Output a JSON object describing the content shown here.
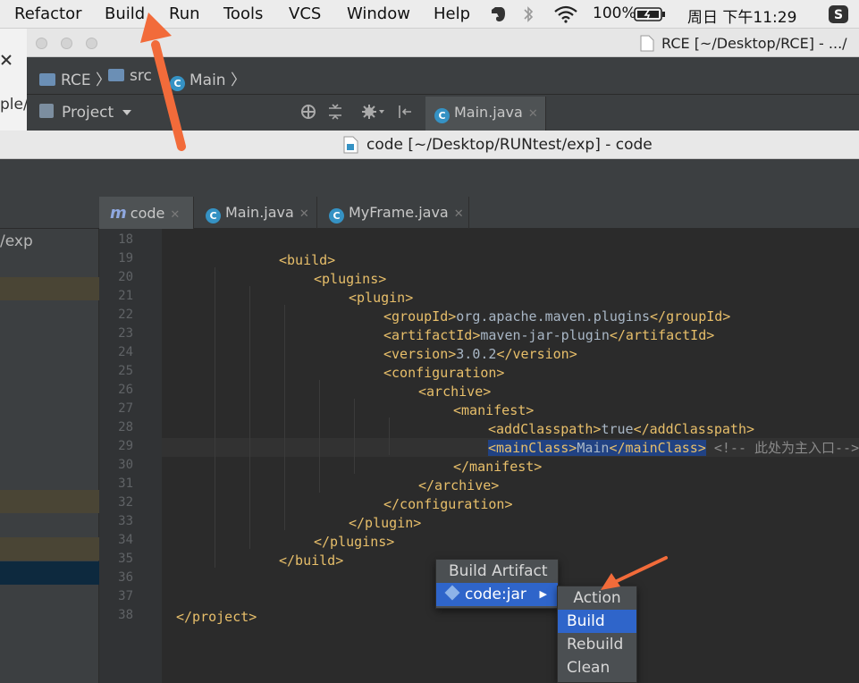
{
  "menubar": {
    "items": [
      "Refactor",
      "Build",
      "Run",
      "Tools",
      "VCS",
      "Window",
      "Help"
    ],
    "battery": "100%",
    "clock": "周日 下午11:29"
  },
  "back_window": {
    "title": "RCE [~/Desktop/RCE] - .../",
    "breadcrumb": [
      "RCE",
      "src",
      "Main"
    ],
    "project_label": "Project",
    "tab": "Main.java",
    "left_fragment": "ple/e"
  },
  "front_window": {
    "title": "code [~/Desktop/RUNtest/exp] - code",
    "tabs": [
      {
        "label": "code",
        "icon": "maven-icon"
      },
      {
        "label": "Main.java",
        "icon": "class-icon"
      },
      {
        "label": "MyFrame.java",
        "icon": "class-icon"
      }
    ],
    "project_path_fragment": "/exp"
  },
  "editor": {
    "lines": [
      {
        "n": "18",
        "open": "",
        "text": "",
        "close": ""
      },
      {
        "n": "19",
        "open": "<build>",
        "text": "",
        "close": ""
      },
      {
        "n": "20",
        "open": "<plugins>",
        "text": "",
        "close": ""
      },
      {
        "n": "21",
        "open": "<plugin>",
        "text": "",
        "close": ""
      },
      {
        "n": "22",
        "open": "<groupId>",
        "text": "org.apache.maven.plugins",
        "close": "</groupId>"
      },
      {
        "n": "23",
        "open": "<artifactId>",
        "text": "maven-jar-plugin",
        "close": "</artifactId>"
      },
      {
        "n": "24",
        "open": "<version>",
        "text": "3.0.2",
        "close": "</version>"
      },
      {
        "n": "25",
        "open": "<configuration>",
        "text": "",
        "close": ""
      },
      {
        "n": "26",
        "open": "<archive>",
        "text": "",
        "close": ""
      },
      {
        "n": "27",
        "open": "<manifest>",
        "text": "",
        "close": ""
      },
      {
        "n": "28",
        "open": "<addClasspath>",
        "text": "true",
        "close": "</addClasspath>"
      },
      {
        "n": "29",
        "open": "<mainClass>",
        "text": "Main",
        "close": "</mainClass>",
        "comment": "<!-- 此处为主入口-->"
      },
      {
        "n": "30",
        "open": "</manifest>",
        "text": "",
        "close": ""
      },
      {
        "n": "31",
        "open": "</archive>",
        "text": "",
        "close": ""
      },
      {
        "n": "32",
        "open": "</configuration>",
        "text": "",
        "close": ""
      },
      {
        "n": "33",
        "open": "</plugin>",
        "text": "",
        "close": ""
      },
      {
        "n": "34",
        "open": "</plugins>",
        "text": "",
        "close": ""
      },
      {
        "n": "35",
        "open": "</build>",
        "text": "",
        "close": ""
      },
      {
        "n": "36",
        "open": "",
        "text": "",
        "close": ""
      },
      {
        "n": "37",
        "open": "",
        "text": "",
        "close": ""
      },
      {
        "n": "38",
        "open": "</project>",
        "text": "",
        "close": ""
      }
    ]
  },
  "popup_build_artifact": {
    "title": "Build Artifact",
    "item": "code:jar"
  },
  "popup_action": {
    "title": "Action",
    "items": [
      "Build",
      "Rebuild",
      "Clean"
    ],
    "selected": "Build"
  },
  "colors": {
    "arrow": "#f26b3a",
    "selection": "#2f65ca",
    "tag": "#e8bf6a"
  }
}
